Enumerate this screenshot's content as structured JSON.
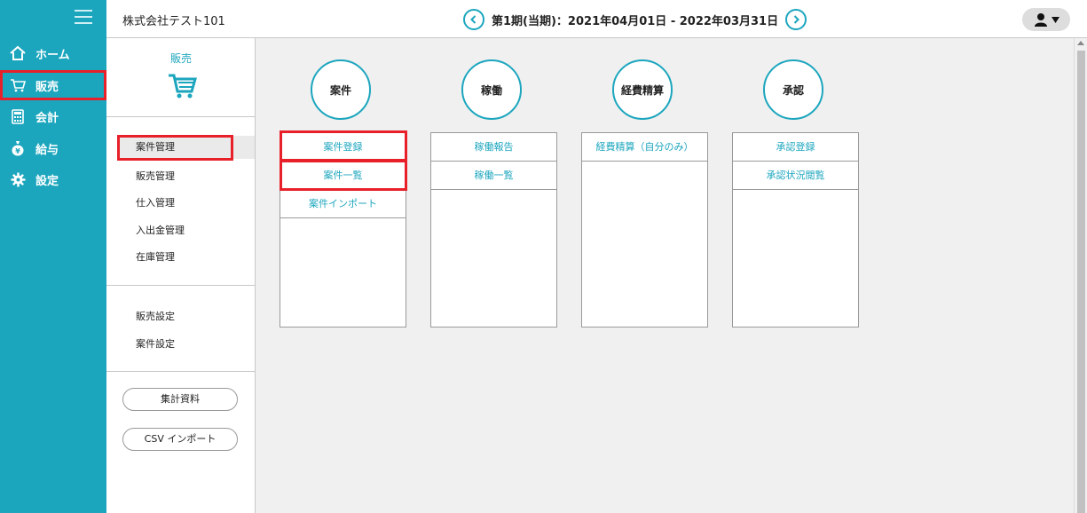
{
  "nav": {
    "items": [
      {
        "label": "ホーム",
        "icon": "home-icon"
      },
      {
        "label": "販売",
        "icon": "cart-icon"
      },
      {
        "label": "会計",
        "icon": "calculator-icon"
      },
      {
        "label": "給与",
        "icon": "money-bag-icon"
      },
      {
        "label": "設定",
        "icon": "gear-icon"
      }
    ],
    "active": "販売"
  },
  "header": {
    "company": "株式会社テスト101",
    "period": "第1期(当期)：2021年04月01日 - 2022年03月31日"
  },
  "submenu": {
    "title": "販売",
    "group1": [
      "案件管理",
      "販売管理",
      "仕入管理",
      "入出金管理",
      "在庫管理"
    ],
    "group2": [
      "販売設定",
      "案件設定"
    ],
    "buttons": [
      "集計資料",
      "CSV インポート"
    ]
  },
  "columns": [
    {
      "title": "案件",
      "links": [
        "案件登録",
        "案件一覧",
        "案件インポート"
      ]
    },
    {
      "title": "稼働",
      "links": [
        "稼働報告",
        "稼働一覧"
      ]
    },
    {
      "title": "経費精算",
      "links": [
        "経費精算（自分のみ）"
      ]
    },
    {
      "title": "承認",
      "links": [
        "承認登録",
        "承認状況閲覧"
      ]
    }
  ],
  "colors": {
    "accent": "#1ca6be",
    "highlight": "#e8202a"
  }
}
